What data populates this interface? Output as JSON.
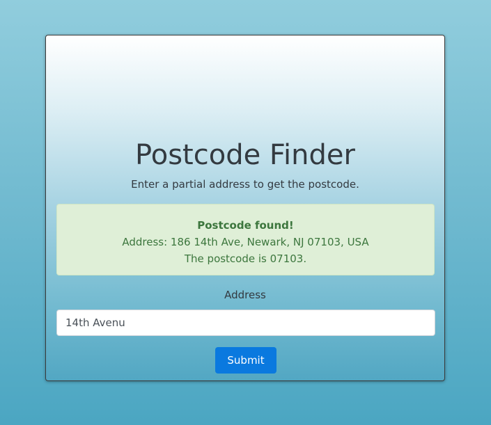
{
  "page": {
    "title": "Postcode Finder",
    "subtitle": "Enter a partial address to get the postcode."
  },
  "alert": {
    "heading": "Postcode found!",
    "address_line": "Address: 186 14th Ave, Newark, NJ 07103, USA",
    "postcode_line": "The postcode is 07103."
  },
  "form": {
    "address_label": "Address",
    "address_value": "14th Avenu",
    "submit_label": "Submit"
  },
  "colors": {
    "accent": "#0a79df",
    "success_bg": "#dfefd7",
    "success_text": "#3c763d"
  }
}
